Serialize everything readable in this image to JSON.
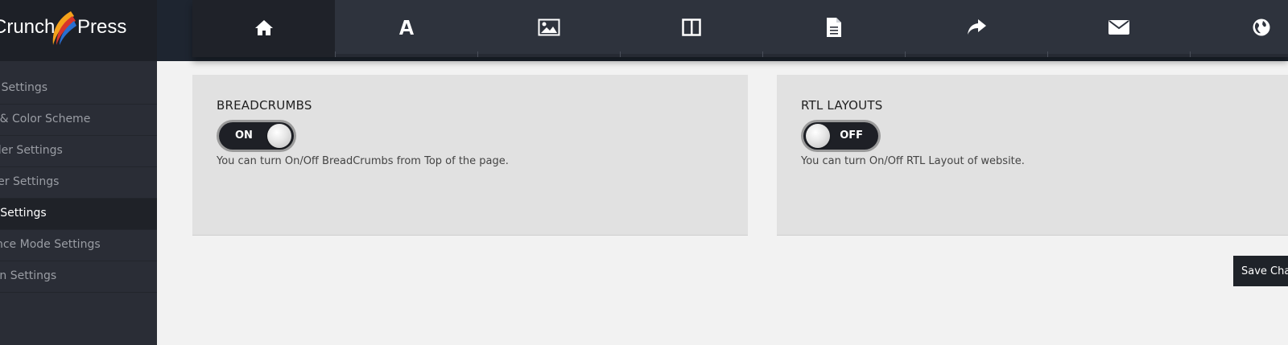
{
  "logo": {
    "text_left": "Crunch",
    "text_right": "Press",
    "mark": "colorful-swoosh"
  },
  "sidebar": {
    "items": [
      {
        "label": "General Settings",
        "icon": "none"
      },
      {
        "label": "Style & Color Scheme",
        "icon": "none"
      },
      {
        "label": "Header Settings",
        "icon": "none"
      },
      {
        "label": "Footer Settings",
        "icon": "none"
      },
      {
        "label": "Other Settings",
        "icon": "none",
        "active": true
      },
      {
        "label": "Maintenance Mode Settings",
        "icon": "none"
      },
      {
        "label": "Translation Settings",
        "icon": "none"
      }
    ]
  },
  "tabs": [
    {
      "icon": "home-icon",
      "active": true
    },
    {
      "icon": "font-icon"
    },
    {
      "icon": "image-icon"
    },
    {
      "icon": "columns-icon"
    },
    {
      "icon": "document-icon"
    },
    {
      "icon": "share-icon"
    },
    {
      "icon": "envelope-icon"
    },
    {
      "icon": "globe-icon"
    }
  ],
  "breadcrumbs": {
    "title": "BREADCRUMBS",
    "toggle_state": "ON",
    "description": "You can turn On/Off BreadCrumbs from Top of the page."
  },
  "rtl": {
    "title": "RTL LAYOUTS",
    "toggle_state": "OFF",
    "description": "You can turn On/Off RTL Layout of website."
  },
  "save_label": "Save Changes",
  "colors": {
    "sidebar": "#2a2d36",
    "tabbar": "#2e333d",
    "panel": "#e1e1e1",
    "page": "#f2f2f2"
  }
}
